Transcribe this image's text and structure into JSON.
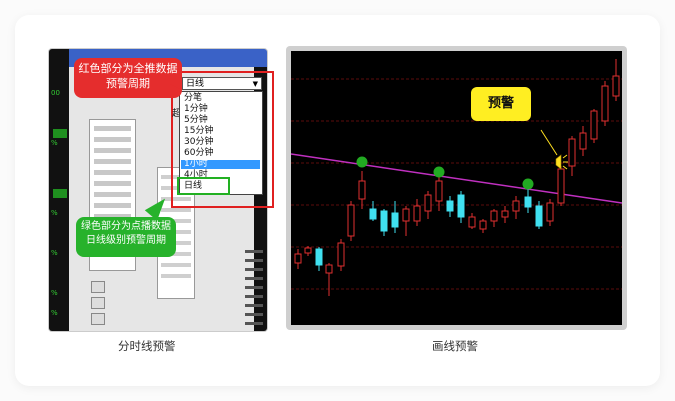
{
  "left_panel": {
    "caption": "分时线预警",
    "red_annotation": "红色部分为全推数据预警周期",
    "green_annotation": "绿色部分为点播数据日线级别预警周期",
    "dropdown_value": "日线",
    "dropdown_options": [
      "分笔",
      "1分钟",
      "5分钟",
      "15分钟",
      "30分钟",
      "60分钟",
      "1小时",
      "4小时",
      "日线"
    ],
    "dropdown_selected_index": 6,
    "hidden_label_char": "超"
  },
  "right_panel": {
    "caption": "画线预警",
    "alert_label": "预警"
  },
  "colors": {
    "red": "#e52d2d",
    "green": "#27b22b",
    "chart_bg": "#000000",
    "trendline": "#c030c0",
    "up_candle": "#e03030",
    "down_candle": "#40e0f0",
    "marker": "#22aa22",
    "alert_bg": "#ffee22"
  },
  "icons": {
    "alert": "bell-alert-icon",
    "marker": "green-dot-marker-icon"
  }
}
